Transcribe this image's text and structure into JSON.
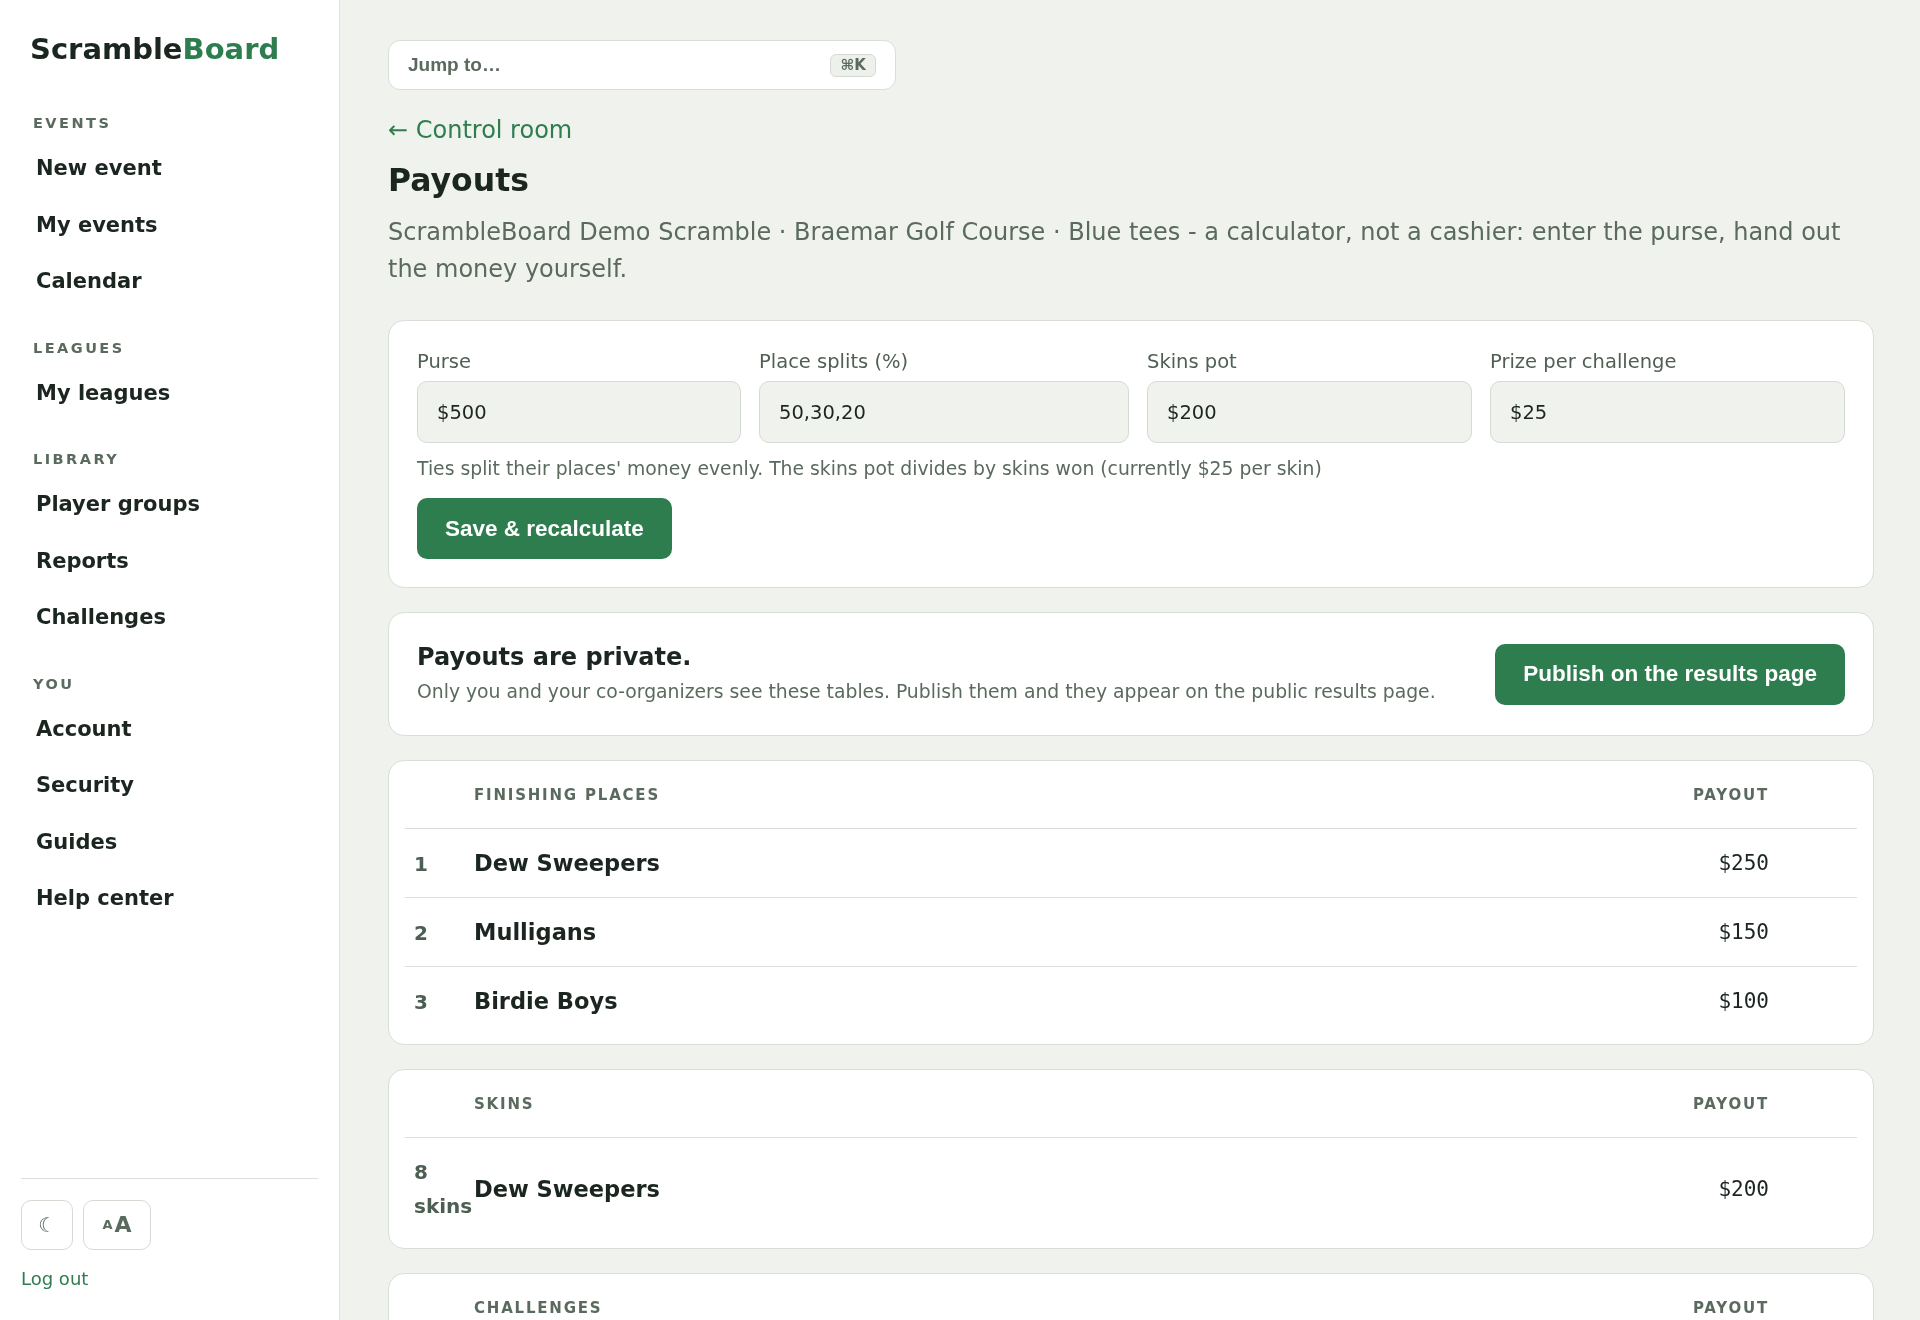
{
  "logo": {
    "text": "Scramble",
    "accent": "Board"
  },
  "sidebar": {
    "sections": [
      {
        "heading": "EVENTS",
        "items": [
          {
            "label": "New event"
          },
          {
            "label": "My events"
          },
          {
            "label": "Calendar"
          }
        ]
      },
      {
        "heading": "LEAGUES",
        "items": [
          {
            "label": "My leagues"
          }
        ]
      },
      {
        "heading": "LIBRARY",
        "items": [
          {
            "label": "Player groups"
          },
          {
            "label": "Reports"
          },
          {
            "label": "Challenges"
          }
        ]
      },
      {
        "heading": "YOU",
        "items": [
          {
            "label": "Account"
          },
          {
            "label": "Security"
          },
          {
            "label": "Guides"
          },
          {
            "label": "Help center"
          }
        ]
      }
    ],
    "footer": {
      "theme_toggle": "☾",
      "text_size": {
        "small": "A",
        "large": "A"
      },
      "logout": "Log out"
    }
  },
  "jump_to": {
    "label": "Jump to…",
    "shortcut": "⌘K"
  },
  "back_link": "← Control room",
  "title": "Payouts",
  "description": "ScrambleBoard Demo Scramble · Braemar Golf Course · Blue tees - a calculator, not a cashier: enter the purse, hand out the money yourself.",
  "settings": {
    "fields": [
      {
        "label": "Purse",
        "value": "$500"
      },
      {
        "label": "Place splits (%)",
        "value": "50,30,20"
      },
      {
        "label": "Skins pot",
        "value": "$200"
      },
      {
        "label": "Prize per challenge",
        "value": "$25"
      }
    ],
    "note": "Ties split their places' money evenly. The skins pot divides by skins won (currently $25 per skin)",
    "button": "Save & recalculate"
  },
  "notice": {
    "title": "Payouts are private.",
    "text": "Only you and your co-organizers see these tables. Publish them and they appear on the public results page.",
    "button": "Publish on the results page"
  },
  "tables": [
    {
      "columns": [
        "FINISHING PLACES",
        "PAYOUT"
      ],
      "rows": [
        {
          "rank": "1",
          "team": "Dew Sweepers",
          "payout": "$250"
        },
        {
          "rank": "2",
          "team": "Mulligans",
          "payout": "$150"
        },
        {
          "rank": "3",
          "team": "Birdie Boys",
          "payout": "$100"
        }
      ]
    },
    {
      "columns": [
        "SKINS",
        "PAYOUT"
      ],
      "rows": [
        {
          "rank": "8 skins",
          "team": "Dew Sweepers",
          "payout": "$200"
        }
      ]
    },
    {
      "columns": [
        "CHALLENGES",
        "PAYOUT"
      ]
    }
  ]
}
